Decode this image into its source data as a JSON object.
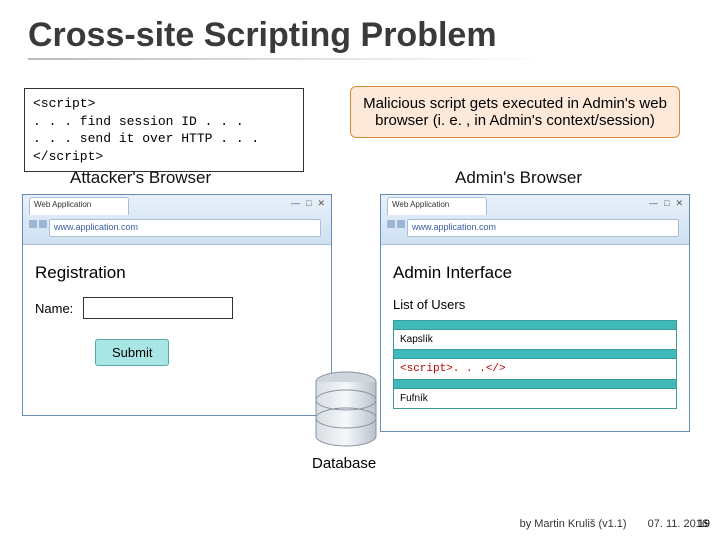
{
  "title": "Cross-site Scripting Problem",
  "code": {
    "l1": "<script>",
    "l2": ". . . find session ID . . .",
    "l3": ". . . send it over HTTP . . .",
    "l4": "</script>"
  },
  "callout": "Malicious script gets executed in Admin's web browser (i. e. , in Admin's context/session)",
  "left": {
    "label": "Attacker's Browser",
    "tab": "Web Application",
    "url": "www.application.com",
    "page_title": "Registration",
    "name_label": "Name:",
    "submit": "Submit"
  },
  "right": {
    "label": "Admin's Browser",
    "tab": "Web Application",
    "url": "www.application.com",
    "page_title": "Admin Interface",
    "list_title": "List of Users",
    "rows": {
      "r1": "Kapslík",
      "r2": "<script>. . .</>",
      "r3": "Fufník"
    }
  },
  "db_label": "Database",
  "footer": {
    "author": "by Martin Kruliš (v1.1)",
    "date": "07. 11. 2016",
    "slide": "19"
  }
}
